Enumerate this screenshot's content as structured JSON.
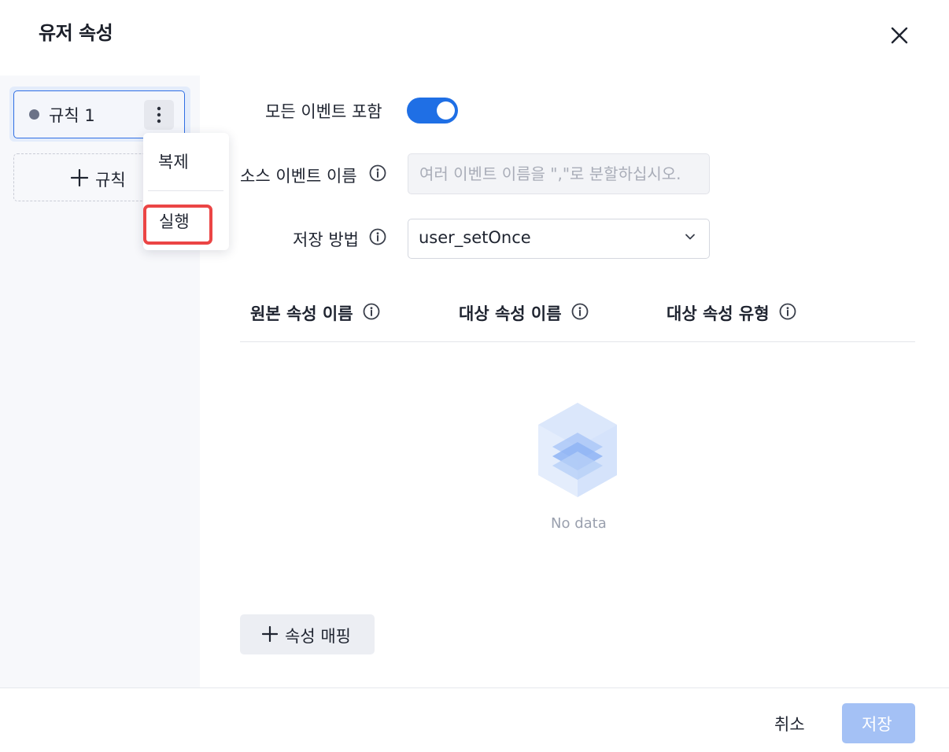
{
  "dialog": {
    "title": "유저 속성"
  },
  "sidebar": {
    "rules": [
      {
        "label": "규칙 1"
      }
    ],
    "add_rule_label": "규칙"
  },
  "context_menu": {
    "items": [
      {
        "label": "복제"
      },
      {
        "label": "실행"
      }
    ]
  },
  "form": {
    "include_all_events": {
      "label": "모든 이벤트 포함",
      "enabled": true
    },
    "source_event_name": {
      "label": "소스 이벤트 이름",
      "placeholder": "여러 이벤트 이름을 \",\"로 분할하십시오."
    },
    "storage_method": {
      "label": "저장 방법",
      "value": "user_setOnce"
    }
  },
  "mapping_table": {
    "columns": [
      {
        "label": "원본 속성 이름"
      },
      {
        "label": "대상 속성 이름"
      },
      {
        "label": "대상 속성 유형"
      }
    ],
    "rows": [],
    "empty_text": "No data"
  },
  "add_mapping_label": "속성 매핑",
  "footer": {
    "cancel_label": "취소",
    "save_label": "저장"
  },
  "colors": {
    "accent": "#1f6fe5",
    "highlight_border": "#eb4545",
    "save_disabled": "#a4c1f5"
  },
  "icons": {
    "close": "close-icon",
    "more": "more-vertical-icon",
    "plus": "plus-icon",
    "info": "info-icon",
    "chevron": "chevron-down-icon",
    "empty": "empty-box-icon"
  }
}
